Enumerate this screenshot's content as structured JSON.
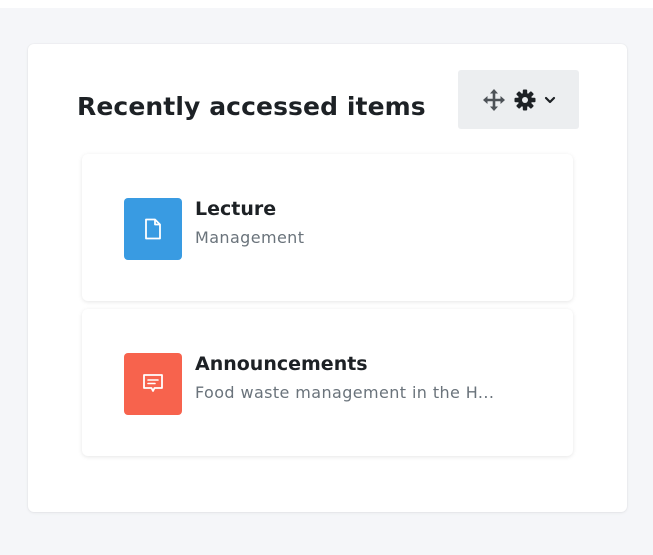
{
  "block": {
    "title": "Recently accessed items",
    "controls": {
      "move_icon": "move-icon",
      "settings_icon": "gear-icon",
      "dropdown_icon": "chevron-down-icon"
    }
  },
  "items": [
    {
      "name": "Lecture",
      "course": "Management",
      "icon": "page-icon",
      "icon_color": "#399be2"
    },
    {
      "name": "Announcements",
      "course": "Food waste management in the H...",
      "icon": "forum-icon",
      "icon_color": "#f7634d"
    }
  ]
}
